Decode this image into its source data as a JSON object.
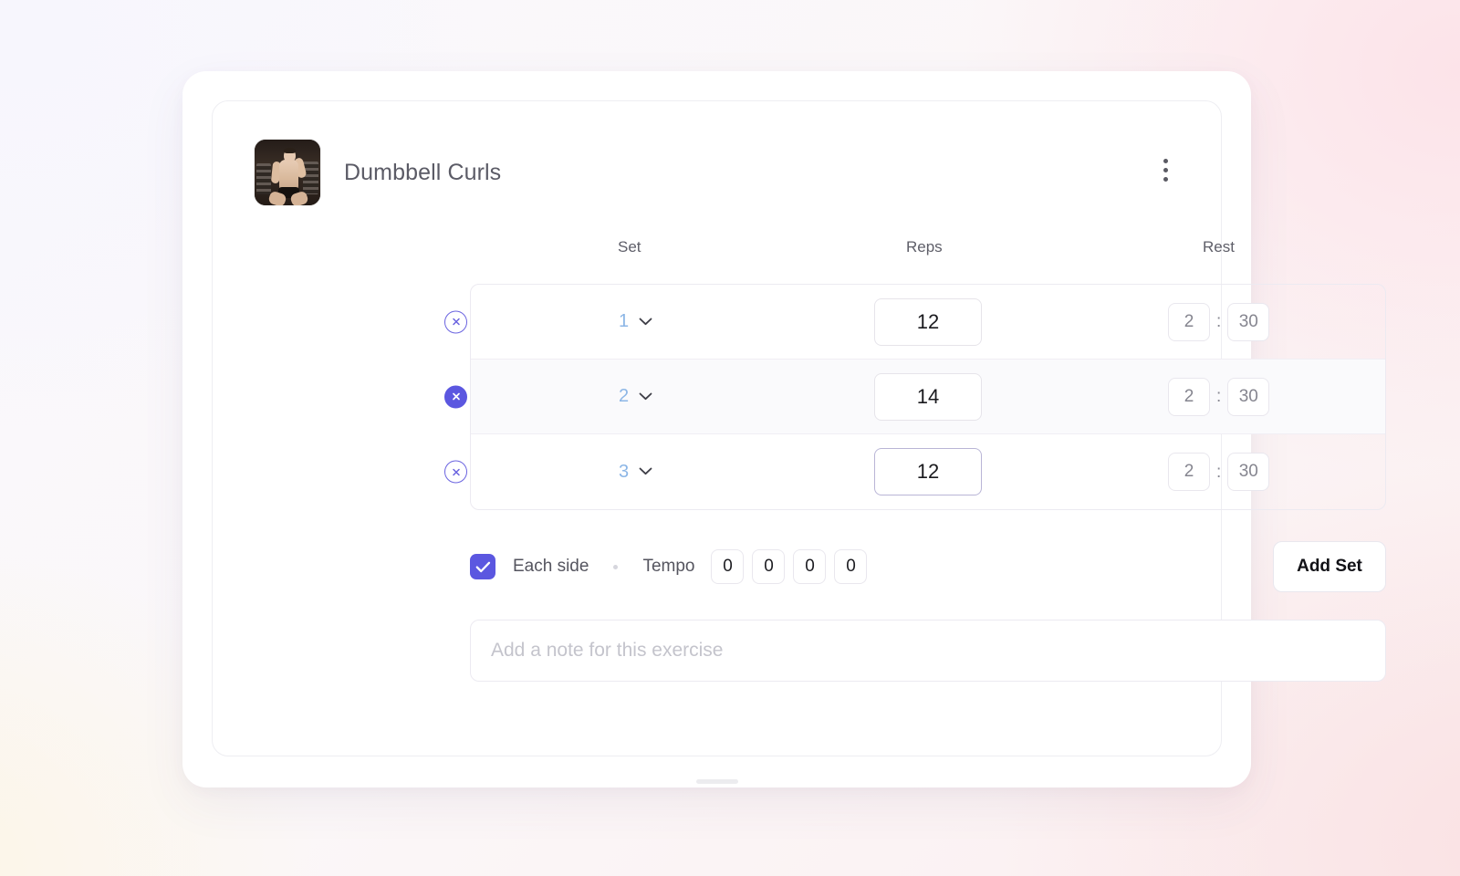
{
  "background": {
    "base_color": "#faf8fc",
    "tint_pink": "#fce2e8",
    "tint_cream": "#fcf6e4",
    "tint_lavender": "#f7f6fd"
  },
  "exercise": {
    "title": "Dumbbell Curls",
    "thumbnail_name": "exercise-thumbnail-photo",
    "menu_icon": "kebab-menu-icon"
  },
  "table": {
    "headers": {
      "set": "Set",
      "reps": "Reps",
      "rest": "Rest"
    },
    "rows": [
      {
        "set": "1",
        "reps": "12",
        "rest_minutes": "2",
        "rest_separator": ":",
        "rest_seconds": "30",
        "delete_icon": "close-circle-icon",
        "delete_state": "outline",
        "row_highlighted": false,
        "reps_focused": false
      },
      {
        "set": "2",
        "reps": "14",
        "rest_minutes": "2",
        "rest_separator": ":",
        "rest_seconds": "30",
        "delete_icon": "close-circle-icon",
        "delete_state": "filled",
        "row_highlighted": true,
        "reps_focused": false
      },
      {
        "set": "3",
        "reps": "12",
        "rest_minutes": "2",
        "rest_separator": ":",
        "rest_seconds": "30",
        "delete_icon": "close-circle-icon",
        "delete_state": "outline",
        "row_highlighted": false,
        "reps_focused": true
      }
    ],
    "set_dropdown_icon": "chevron-down-icon"
  },
  "options": {
    "each_side": {
      "label": "Each side",
      "checked": true,
      "check_icon": "check-icon"
    },
    "tempo": {
      "label": "Tempo",
      "values": [
        "0",
        "0",
        "0",
        "0"
      ]
    },
    "add_set_label": "Add Set"
  },
  "note": {
    "value": "",
    "placeholder": "Add a note for this exercise"
  },
  "colors": {
    "accent_purple": "#5b57e0",
    "set_number_blue": "#8cb6e6",
    "text_primary": "#1a1a1e",
    "text_secondary": "#5e5e68",
    "border_light": "#eceaf1"
  }
}
